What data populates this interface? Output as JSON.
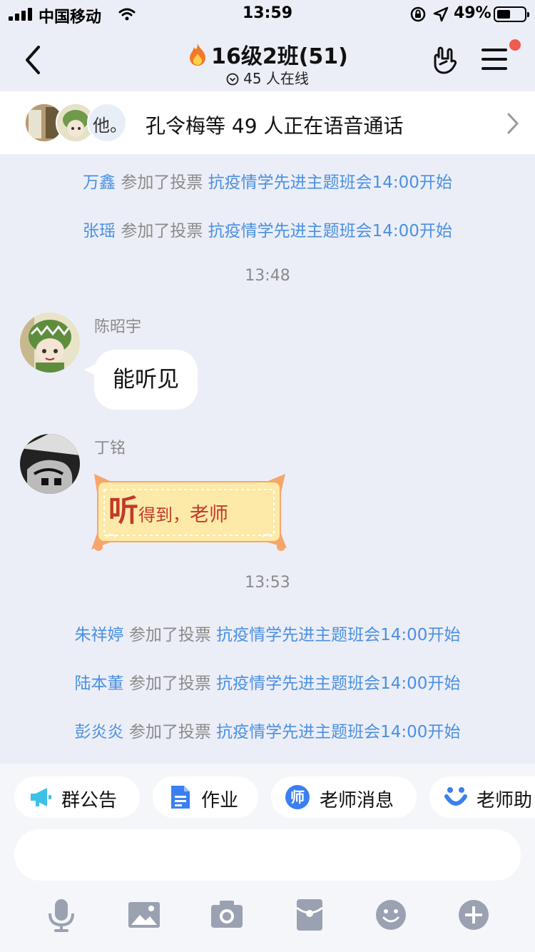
{
  "status_bar": {
    "carrier": "中国移动",
    "time": "13:59",
    "battery": "49%",
    "battery_level": 0.49
  },
  "header": {
    "title": "16级2班(51)",
    "online_text": "45 人在线"
  },
  "voice_call": {
    "avatar3_text": "他。",
    "text": "孔令梅等 49 人正在语音通话"
  },
  "system_messages_top": [
    {
      "name": "万鑫",
      "action": "参加了投票",
      "topic": "抗疫情学先进主题班会14:00开始"
    },
    {
      "name": "张瑶",
      "action": "参加了投票",
      "topic": "抗疫情学先进主题班会14:00开始"
    }
  ],
  "time_1": "13:48",
  "messages": [
    {
      "sender": "陈昭宇",
      "text": "能听见"
    },
    {
      "sender": "丁铭",
      "sticker_big": "听",
      "sticker_small": "得到，",
      "sticker_rest": "老师"
    }
  ],
  "time_2": "13:53",
  "system_messages_bottom": [
    {
      "name": "朱祥婷",
      "action": "参加了投票",
      "topic": "抗疫情学先进主题班会14:00开始"
    },
    {
      "name": "陆本董",
      "action": "参加了投票",
      "topic": "抗疫情学先进主题班会14:00开始"
    },
    {
      "name": "彭炎炎",
      "action": "参加了投票",
      "topic": "抗疫情学先进主题班会14:00开始"
    }
  ],
  "quick_actions": [
    {
      "label": "群公告",
      "icon": "megaphone-icon"
    },
    {
      "label": "作业",
      "icon": "document-icon"
    },
    {
      "label": "老师消息",
      "icon": "teacher-badge-icon"
    },
    {
      "label": "老师助",
      "icon": "assistant-icon"
    }
  ],
  "teacher_badge_char": "师",
  "input": {
    "placeholder": ""
  },
  "toolbar": [
    "microphone-icon",
    "image-icon",
    "camera-icon",
    "red-packet-icon",
    "emoji-icon",
    "plus-icon"
  ],
  "colors": {
    "accent": "#4a90e2",
    "badge": "#f05a4f",
    "background": "#eceef7"
  }
}
